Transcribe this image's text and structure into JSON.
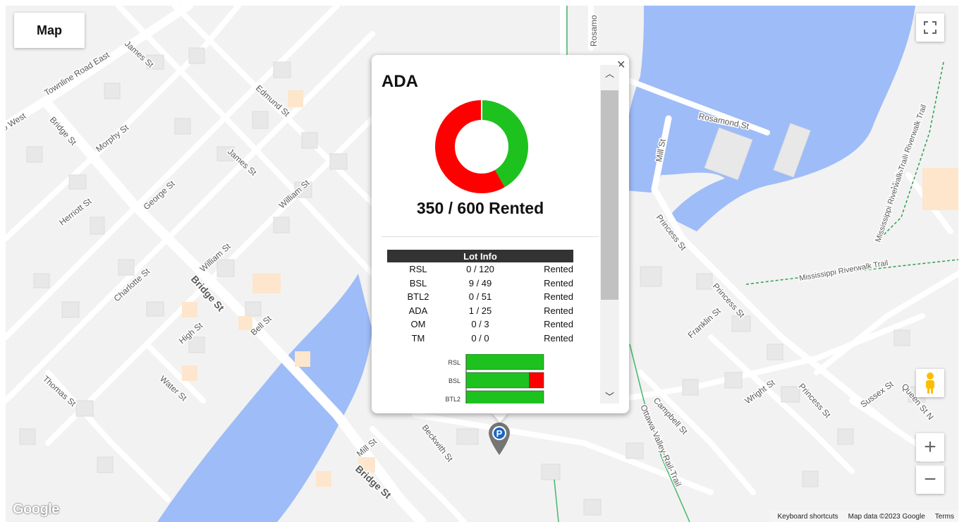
{
  "map": {
    "type_button": "Map",
    "google_logo": "Google",
    "attribution": {
      "keyboard": "Keyboard shortcuts",
      "data": "Map data ©2023 Google",
      "terms": "Terms"
    },
    "street_labels": {
      "townline": "Townline Road East",
      "west": "o West",
      "bridge1": "Bridge St",
      "bridge2": "Bridge St",
      "bridge3": "Bridge St",
      "james1": "James St",
      "james2": "James St",
      "edmund": "Edmund St",
      "morphy": "Morphy St",
      "george": "George St",
      "herriott": "Herriott St",
      "william1": "William St",
      "william2": "William St",
      "charlotte": "Charlotte St",
      "high": "High St",
      "bell": "Bell St",
      "thomas": "Thomas St",
      "water": "Water St",
      "mill1": "Mill St",
      "mill2": "Mill St",
      "beckwith": "Beckwith St",
      "rosamond1": "Rosamond St",
      "rosamond2": "Rosamo",
      "princess1": "Princess St",
      "princess2": "Princess St",
      "princess3": "Princess St",
      "franklin": "Franklin St",
      "wright": "Wright St",
      "sussex": "Sussex St",
      "queen": "Queen St N",
      "campbell": "Campbell St",
      "ottawa": "Ottawa-Valley-Rail-Trail",
      "riverwalk1": "Mississippi Riverwalk Trail",
      "riverwalk2": "Mississippi Riverwalk Trail",
      "riverwalk3": "Mississippi Riverwalk Trail"
    }
  },
  "popup": {
    "title": "ADA",
    "rented_summary": "350 / 600 Rented",
    "donut": {
      "rented": 350,
      "total": 600,
      "colors": {
        "available": "#1ec21e",
        "rented": "#ff0000"
      }
    },
    "lot_info": {
      "header": "Lot Info",
      "rows": [
        {
          "name": "RSL",
          "count": "0 / 120",
          "status": "Rented"
        },
        {
          "name": "BSL",
          "count": "9 / 49",
          "status": "Rented"
        },
        {
          "name": "BTL2",
          "count": "0 / 51",
          "status": "Rented"
        },
        {
          "name": "ADA",
          "count": "1 / 25",
          "status": "Rented"
        },
        {
          "name": "OM",
          "count": "0 / 3",
          "status": "Rented"
        },
        {
          "name": "TM",
          "count": "0 / 0",
          "status": "Rented"
        }
      ]
    }
  },
  "chart_data": {
    "type": "bar",
    "orientation": "horizontal",
    "stacked": true,
    "categories": [
      "RSL",
      "BSL",
      "BTL2"
    ],
    "series": [
      {
        "values": [
          0,
          9,
          0
        ],
        "color": "#ff0000"
      },
      {
        "values": [
          120,
          40,
          51
        ],
        "color": "#1ec21e"
      }
    ]
  }
}
